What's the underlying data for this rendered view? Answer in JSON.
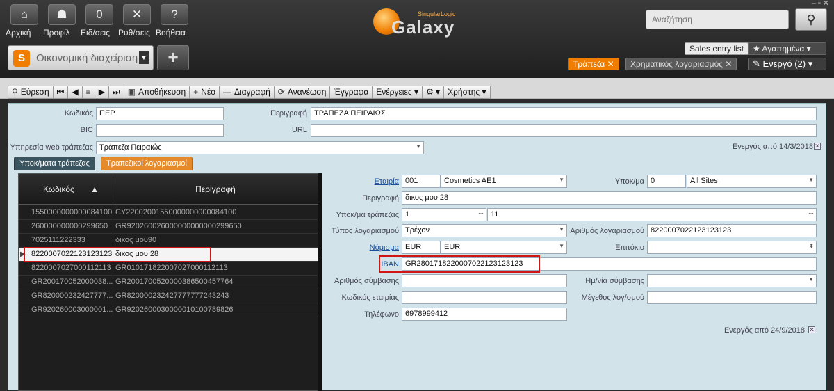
{
  "nav": [
    {
      "label": "Αρχική",
      "glyph": "⌂"
    },
    {
      "label": "Προφίλ",
      "glyph": "☗"
    },
    {
      "label": "Ειδ/σεις",
      "glyph": "0"
    },
    {
      "label": "Ρυθ/σεις",
      "glyph": "✕"
    },
    {
      "label": "Βοήθεια",
      "glyph": "?"
    }
  ],
  "module": {
    "label": "Οικονομική διαχείριση"
  },
  "logo": {
    "brand": "Galaxy",
    "sub": "SingularLogic"
  },
  "search": {
    "placeholder": "Αναζήτηση"
  },
  "topright": {
    "sales_entry": "Sales entry list",
    "favorites": "★ Αγαπημένα ▾",
    "tab_bank": "Τράπεζα ✕",
    "tab_account": "Χρηματικός λογαριασμός ✕",
    "active": "✎ Ενεργό (2) ▾"
  },
  "toolbar": {
    "find": "Εύρεση",
    "save": "Αποθήκευση",
    "new": "Νέο",
    "delete": "Διαγραφή",
    "refresh": "Ανανέωση",
    "docs": "Έγγραφα",
    "actions": "Ενέργειες ▾",
    "user": "Χρήστης ▾"
  },
  "header_form": {
    "code_label": "Κωδικός",
    "code_value": "ΠΕΡ",
    "desc_label": "Περιγραφή",
    "desc_value": "ΤΡΑΠΕΖΑ ΠΕΙΡΑΙΩΣ",
    "bic_label": "BIC",
    "bic_value": "",
    "url_label": "URL",
    "url_value": "",
    "webservice_label": "Υπηρεσία web τράπεζας",
    "webservice_value": "Τράπεζα Πειραιώς",
    "active_from": "Ενεργός από 14/3/2018"
  },
  "subtabs": {
    "branches": "Υποκ/ματα τράπεζας",
    "accounts": "Τραπεζικοί λογαριασμοί"
  },
  "grid": {
    "col_code": "Κωδικός",
    "col_desc": "Περιγραφή",
    "rows": [
      {
        "code": "1550000000000084100",
        "desc": "CY22002001550000000000084100"
      },
      {
        "code": "260000000000299650",
        "desc": "GR920260026000000000000299650"
      },
      {
        "code": "7025111222333",
        "desc": "δικος μου90"
      },
      {
        "code": "8220007022123123123",
        "desc": "δικος μου 28"
      },
      {
        "code": "8220007027000112113",
        "desc": "GR010171822007027000112113"
      },
      {
        "code": "GR200170052000038...",
        "desc": "GR200170052000038650045​7764"
      },
      {
        "code": "GR820000232427777...",
        "desc": "GR820000232427777777243243"
      },
      {
        "code": "GR920260003000001...",
        "desc": "GR920260003000001010078982​6"
      }
    ]
  },
  "detail": {
    "company_label": "Εταιρία",
    "company_code": "001",
    "company_name": "Cosmetics AE1",
    "branch_label": "Υποκ/μα",
    "branch_code": "0",
    "branch_name": "All Sites",
    "desc_label": "Περιγραφή",
    "desc_value": "δικος μου 28",
    "bank_branch_label": "Υποκ/μα τράπεζας",
    "bank_branch_code": "1",
    "bank_branch_name": "11",
    "account_type_label": "Τύπος λογαριασμού",
    "account_type_value": "Τρέχον",
    "account_no_label": "Αριθμός λογαριασμού",
    "account_no_value": "8220007022123123123",
    "currency_label": "Νόμισμα",
    "currency_code": "EUR",
    "currency_name": "EUR",
    "interest_label": "Επιτόκιο",
    "interest_value": "",
    "iban_label": "IBAN",
    "iban_value": "GR2801718220007022123123123",
    "contract_no_label": "Αριθμός σύμβασης",
    "contract_no_value": "",
    "contract_date_label": "Ημ/νία σύμβασης",
    "contract_date_value": "",
    "company_code_label": "Κωδικός εταιρίας",
    "company_code_value": "",
    "account_size_label": "Μέγεθος λογ/σμού",
    "account_size_value": "",
    "phone_label": "Τηλέφωνο",
    "phone_value": "6978999412",
    "active_from": "Ενεργός από 24/9/2018"
  }
}
